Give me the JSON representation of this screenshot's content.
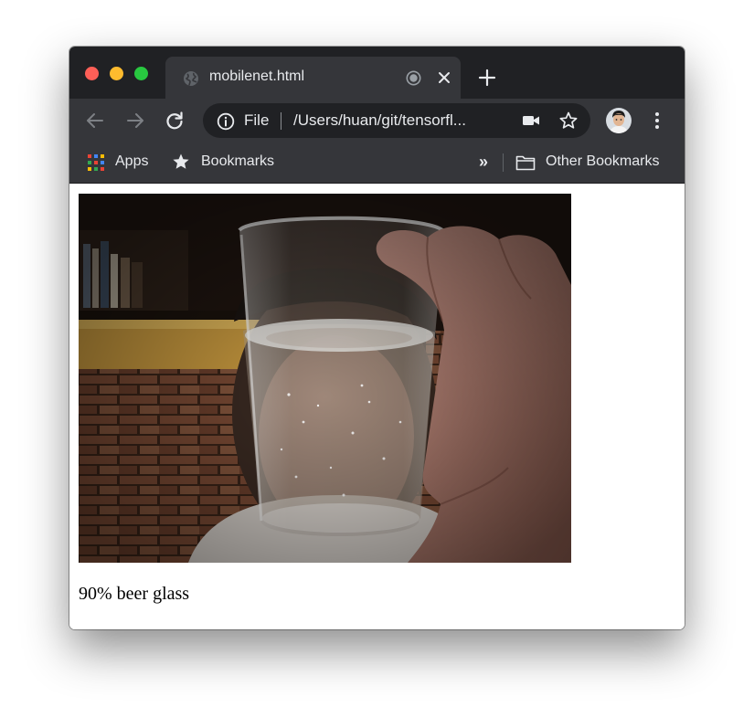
{
  "tab": {
    "title": "mobilenet.html"
  },
  "toolbar": {
    "scheme_label": "File",
    "url": "/Users/huan/git/tensorfl..."
  },
  "bookmarks_bar": {
    "apps_label": "Apps",
    "bookmarks_label": "Bookmarks",
    "more_label": "»",
    "other_label": "Other Bookmarks"
  },
  "page": {
    "prediction": "90% beer glass"
  },
  "colors": {
    "tabstrip": "#202124",
    "toolbar": "#35363a",
    "omnibox": "#202124",
    "text_light": "#e8eaed",
    "close_button": "#fd5f57",
    "minimize_button": "#febb2e",
    "maximize_button": "#28c840"
  }
}
